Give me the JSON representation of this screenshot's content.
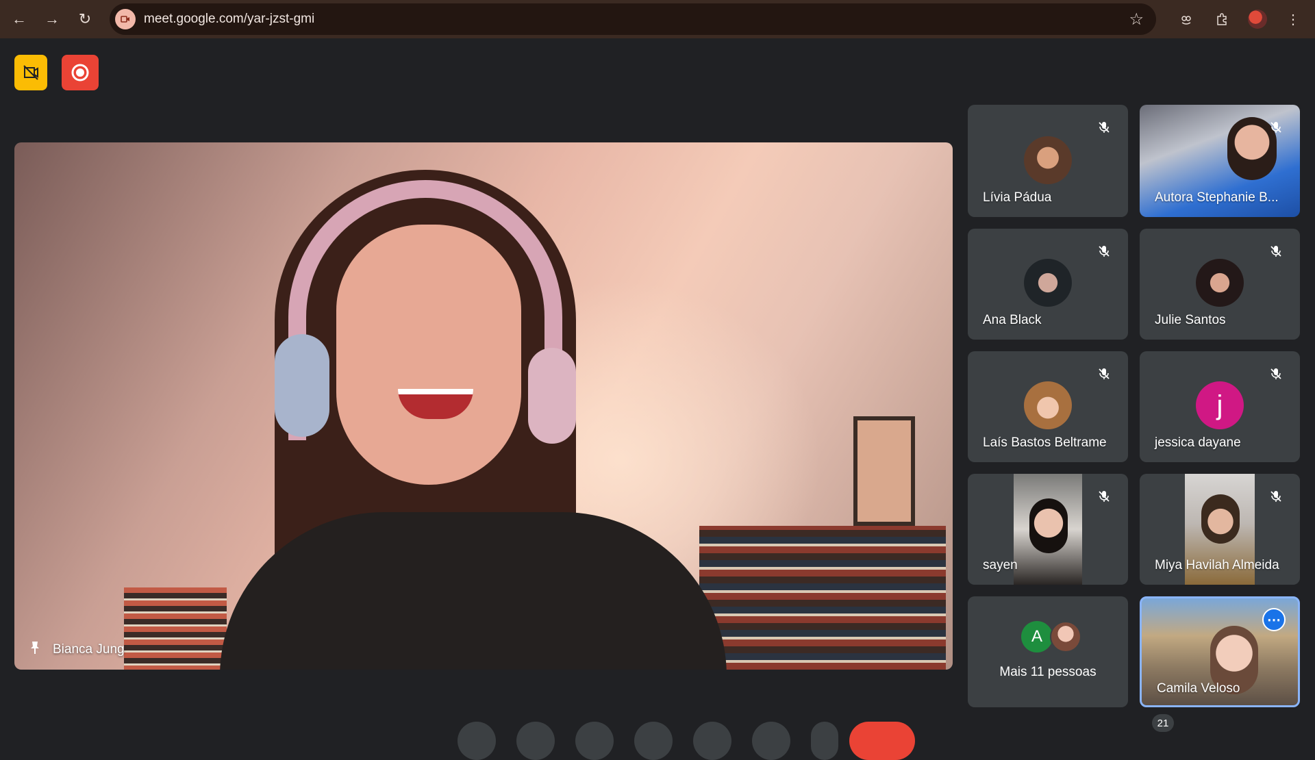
{
  "browser": {
    "url": "meet.google.com/yar-jzst-gmi",
    "icons": [
      "back-icon",
      "forward-icon",
      "reload-icon",
      "bookmark-star-icon",
      "extension-owl-icon",
      "extensions-puzzle-icon",
      "profile-avatar",
      "menu-kebab-icon"
    ]
  },
  "meet": {
    "top_buttons": [
      "no-video-icon",
      "record-icon"
    ],
    "main_speaker": {
      "name": "Bianca Jung",
      "icon": "pin-icon"
    },
    "participants": [
      {
        "name": "Lívia Pádua",
        "type": "avatar",
        "muted": true
      },
      {
        "name": "Autora Stephanie B...",
        "type": "video",
        "muted": true
      },
      {
        "name": "Ana Black",
        "type": "avatar",
        "muted": true
      },
      {
        "name": "Julie Santos",
        "type": "avatar",
        "muted": true
      },
      {
        "name": "Laís Bastos Beltrame",
        "type": "avatar",
        "muted": true
      },
      {
        "name": "jessica dayane",
        "type": "letter",
        "letter": "j",
        "color": "#d01884",
        "muted": true
      },
      {
        "name": "sayen",
        "type": "video",
        "muted": true
      },
      {
        "name": "Miya Havilah Almeida",
        "type": "video",
        "muted": true
      },
      {
        "name": "Camila Veloso",
        "type": "video",
        "muted": false,
        "selected": true
      }
    ],
    "more": {
      "label": "Mais 11 pessoas",
      "letter": "A",
      "color": "#1e8e3e"
    },
    "participant_count": "21",
    "colors": {
      "accent": "#8ab4f8",
      "end_call": "#ea4335",
      "badge_yellow": "#fbbc04"
    }
  }
}
